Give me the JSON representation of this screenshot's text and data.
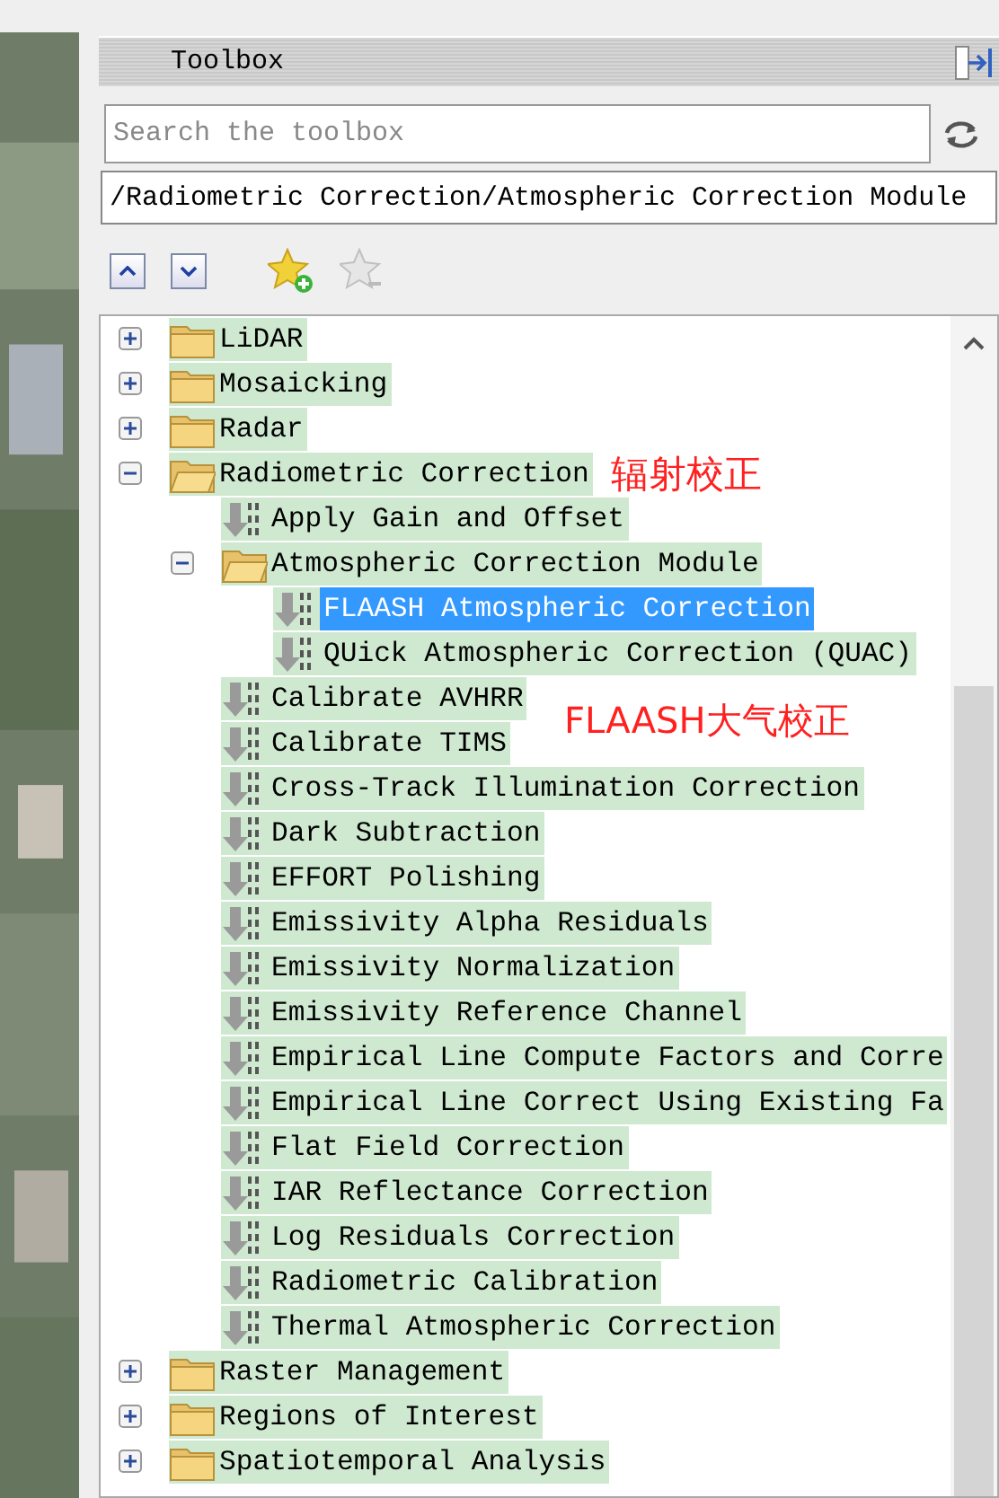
{
  "panel": {
    "title": "Toolbox"
  },
  "search": {
    "placeholder": "Search the toolbox"
  },
  "path": {
    "value": "/Radiometric Correction/Atmospheric Correction Module"
  },
  "tree": [
    {
      "label": "LiDAR",
      "kind": "folder",
      "expanded": false,
      "selected": false
    },
    {
      "label": "Mosaicking",
      "kind": "folder",
      "expanded": false,
      "selected": false
    },
    {
      "label": "Radar",
      "kind": "folder",
      "expanded": false,
      "selected": false
    },
    {
      "label": "Radiometric Correction",
      "kind": "folder",
      "expanded": true,
      "selected": false,
      "note": "辐射校正",
      "children": [
        {
          "label": "Apply Gain and Offset",
          "kind": "tool",
          "selected": false
        },
        {
          "label": "Atmospheric Correction Module",
          "kind": "folder",
          "expanded": true,
          "selected": false,
          "children": [
            {
              "label": "FLAASH Atmospheric Correction",
              "kind": "tool",
              "selected": true
            },
            {
              "label": "QUick Atmospheric Correction (QUAC)",
              "kind": "tool",
              "selected": false
            }
          ]
        },
        {
          "label": "Calibrate AVHRR",
          "kind": "tool",
          "selected": false
        },
        {
          "label": "Calibrate TIMS",
          "kind": "tool",
          "selected": false
        },
        {
          "label": "Cross-Track Illumination Correction",
          "kind": "tool",
          "selected": false
        },
        {
          "label": "Dark Subtraction",
          "kind": "tool",
          "selected": false
        },
        {
          "label": "EFFORT Polishing",
          "kind": "tool",
          "selected": false
        },
        {
          "label": "Emissivity Alpha Residuals",
          "kind": "tool",
          "selected": false
        },
        {
          "label": "Emissivity Normalization",
          "kind": "tool",
          "selected": false
        },
        {
          "label": "Emissivity Reference Channel",
          "kind": "tool",
          "selected": false
        },
        {
          "label": "Empirical Line Compute Factors and Corre",
          "kind": "tool",
          "selected": false
        },
        {
          "label": "Empirical Line Correct Using Existing Fa",
          "kind": "tool",
          "selected": false
        },
        {
          "label": "Flat Field Correction",
          "kind": "tool",
          "selected": false
        },
        {
          "label": "IAR Reflectance Correction",
          "kind": "tool",
          "selected": false
        },
        {
          "label": "Log Residuals Correction",
          "kind": "tool",
          "selected": false
        },
        {
          "label": "Radiometric Calibration",
          "kind": "tool",
          "selected": false
        },
        {
          "label": "Thermal Atmospheric Correction",
          "kind": "tool",
          "selected": false
        }
      ]
    },
    {
      "label": "Raster Management",
      "kind": "folder",
      "expanded": false,
      "selected": false
    },
    {
      "label": "Regions of Interest",
      "kind": "folder",
      "expanded": false,
      "selected": false
    },
    {
      "label": "Spatiotemporal Analysis",
      "kind": "folder",
      "expanded": false,
      "selected": false
    }
  ],
  "overlay_note": "FLAASH大气校正"
}
